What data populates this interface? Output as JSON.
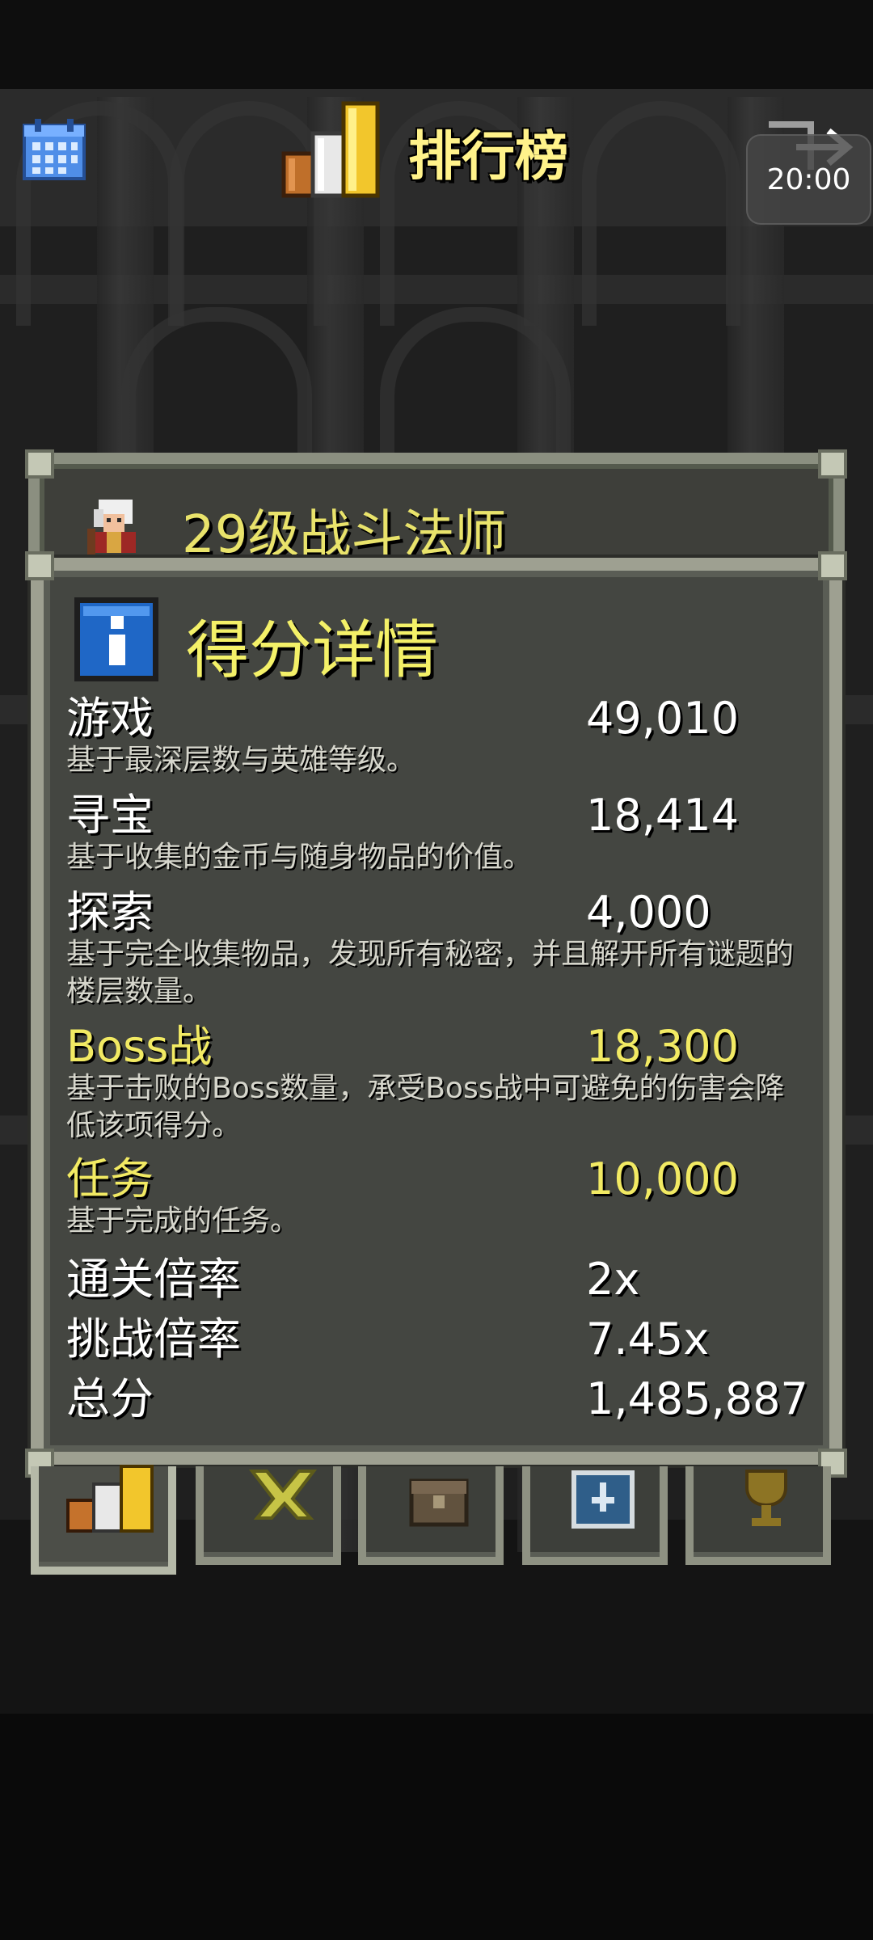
{
  "header": {
    "title": "排行榜",
    "time": "20:00",
    "calendar_icon": "calendar-icon",
    "exit_icon": "exit-icon"
  },
  "background_panel": {
    "hero_title": "29级战斗法师",
    "hero_icon": "battlemage-hero-icon"
  },
  "dialog": {
    "title": "得分详情",
    "icon": "info-icon",
    "rows": [
      {
        "label": "游戏",
        "value": "49,010",
        "description": "基于最深层数与英雄等级。"
      },
      {
        "label": "寻宝",
        "value": "18,414",
        "description": "基于收集的金币与随身物品的价值。"
      },
      {
        "label": "探索",
        "value": "4,000",
        "description": "基于完全收集物品，发现所有秘密，并且解开所有谜题的楼层数量。"
      },
      {
        "label": "Boss战",
        "value": "18,300",
        "description": "基于击败的Boss数量，承受Boss战中可避免的伤害会降低该项得分。"
      },
      {
        "label": "任务",
        "value": "10,000",
        "description": "基于完成的任务。"
      },
      {
        "label": "通关倍率",
        "value": "2x"
      },
      {
        "label": "挑战倍率",
        "value": "7.45x"
      },
      {
        "label": "总分",
        "value": "1,485,887"
      }
    ]
  },
  "tabs": [
    {
      "icon": "rankings-icon"
    },
    {
      "icon": "badges-icon"
    },
    {
      "icon": "journal-chest-icon"
    },
    {
      "icon": "catalog-icon"
    },
    {
      "icon": "trophy-icon"
    }
  ],
  "colors": {
    "title_gold": "#fff28a",
    "highlight_gold": "#f2ea63",
    "panel_border": "#9ea091"
  }
}
